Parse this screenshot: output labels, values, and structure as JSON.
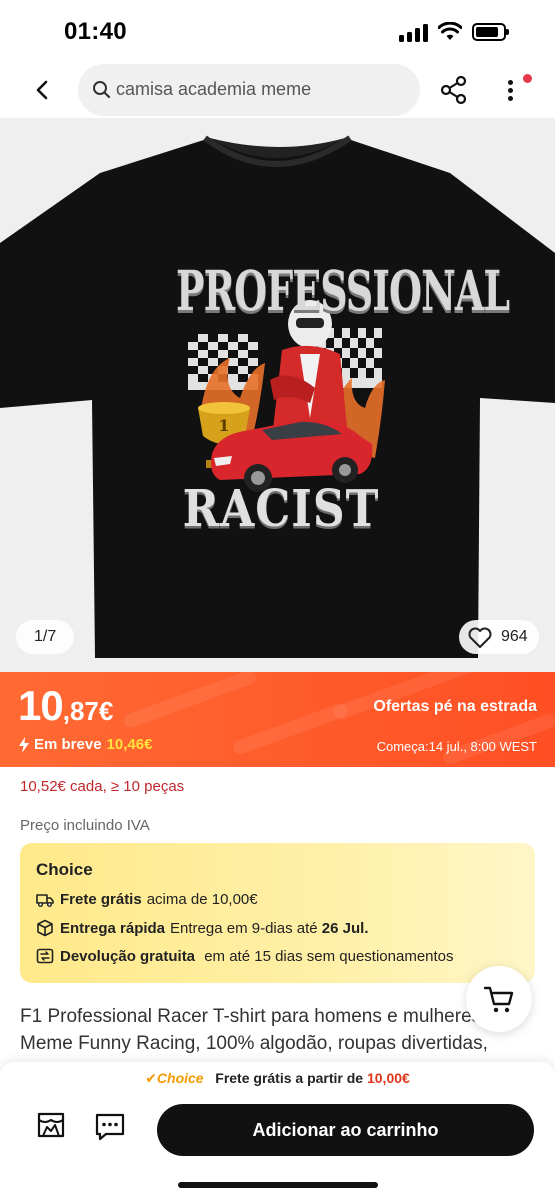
{
  "status": {
    "time": "01:40"
  },
  "nav": {
    "search_query": "camisa academia meme"
  },
  "gallery": {
    "shirt_text_top": "PROFESSIONAL",
    "shirt_text_bottom": "RACIST",
    "pager": "1/7",
    "likes": "964"
  },
  "price": {
    "integer": "10",
    "decimal": ",87€",
    "soon_label": "Em breve",
    "soon_price": "10,46€",
    "offer_label": "Ofertas pé na estrada",
    "starts": "Começa:14 jul., 8:00 WEST"
  },
  "bulk_price": "10,52€ cada, ≥ 10 peças",
  "vat_note": "Preço incluindo IVA",
  "choice": {
    "title": "Choice",
    "shipping_bold": "Frete grátis",
    "shipping_text": "acima de 10,00€",
    "fast_bold": "Entrega rápida",
    "fast_text": "Entrega em 9-dias até",
    "fast_date": "26 Jul.",
    "return_bold": "Devolução gratuita",
    "return_text": "em até 15 dias sem questionamentos"
  },
  "product_title": "F1 Professional Racer T-shirt para homens e mulheres, Meme Funny Racing, 100% algodão, roupas divertidas, mercadoria",
  "bottom": {
    "choice_label": "✔Choice",
    "free_shipping_text": "Frete grátis a partir de",
    "free_shipping_amount": "10,00€",
    "add_to_cart": "Adicionar ao carrinho"
  },
  "colors": {
    "accent": "#ff5a2a",
    "soon_price": "#ffe23a",
    "bulk_price": "#c1272d",
    "choice_bg": "#ffe98a",
    "button": "#111111"
  }
}
